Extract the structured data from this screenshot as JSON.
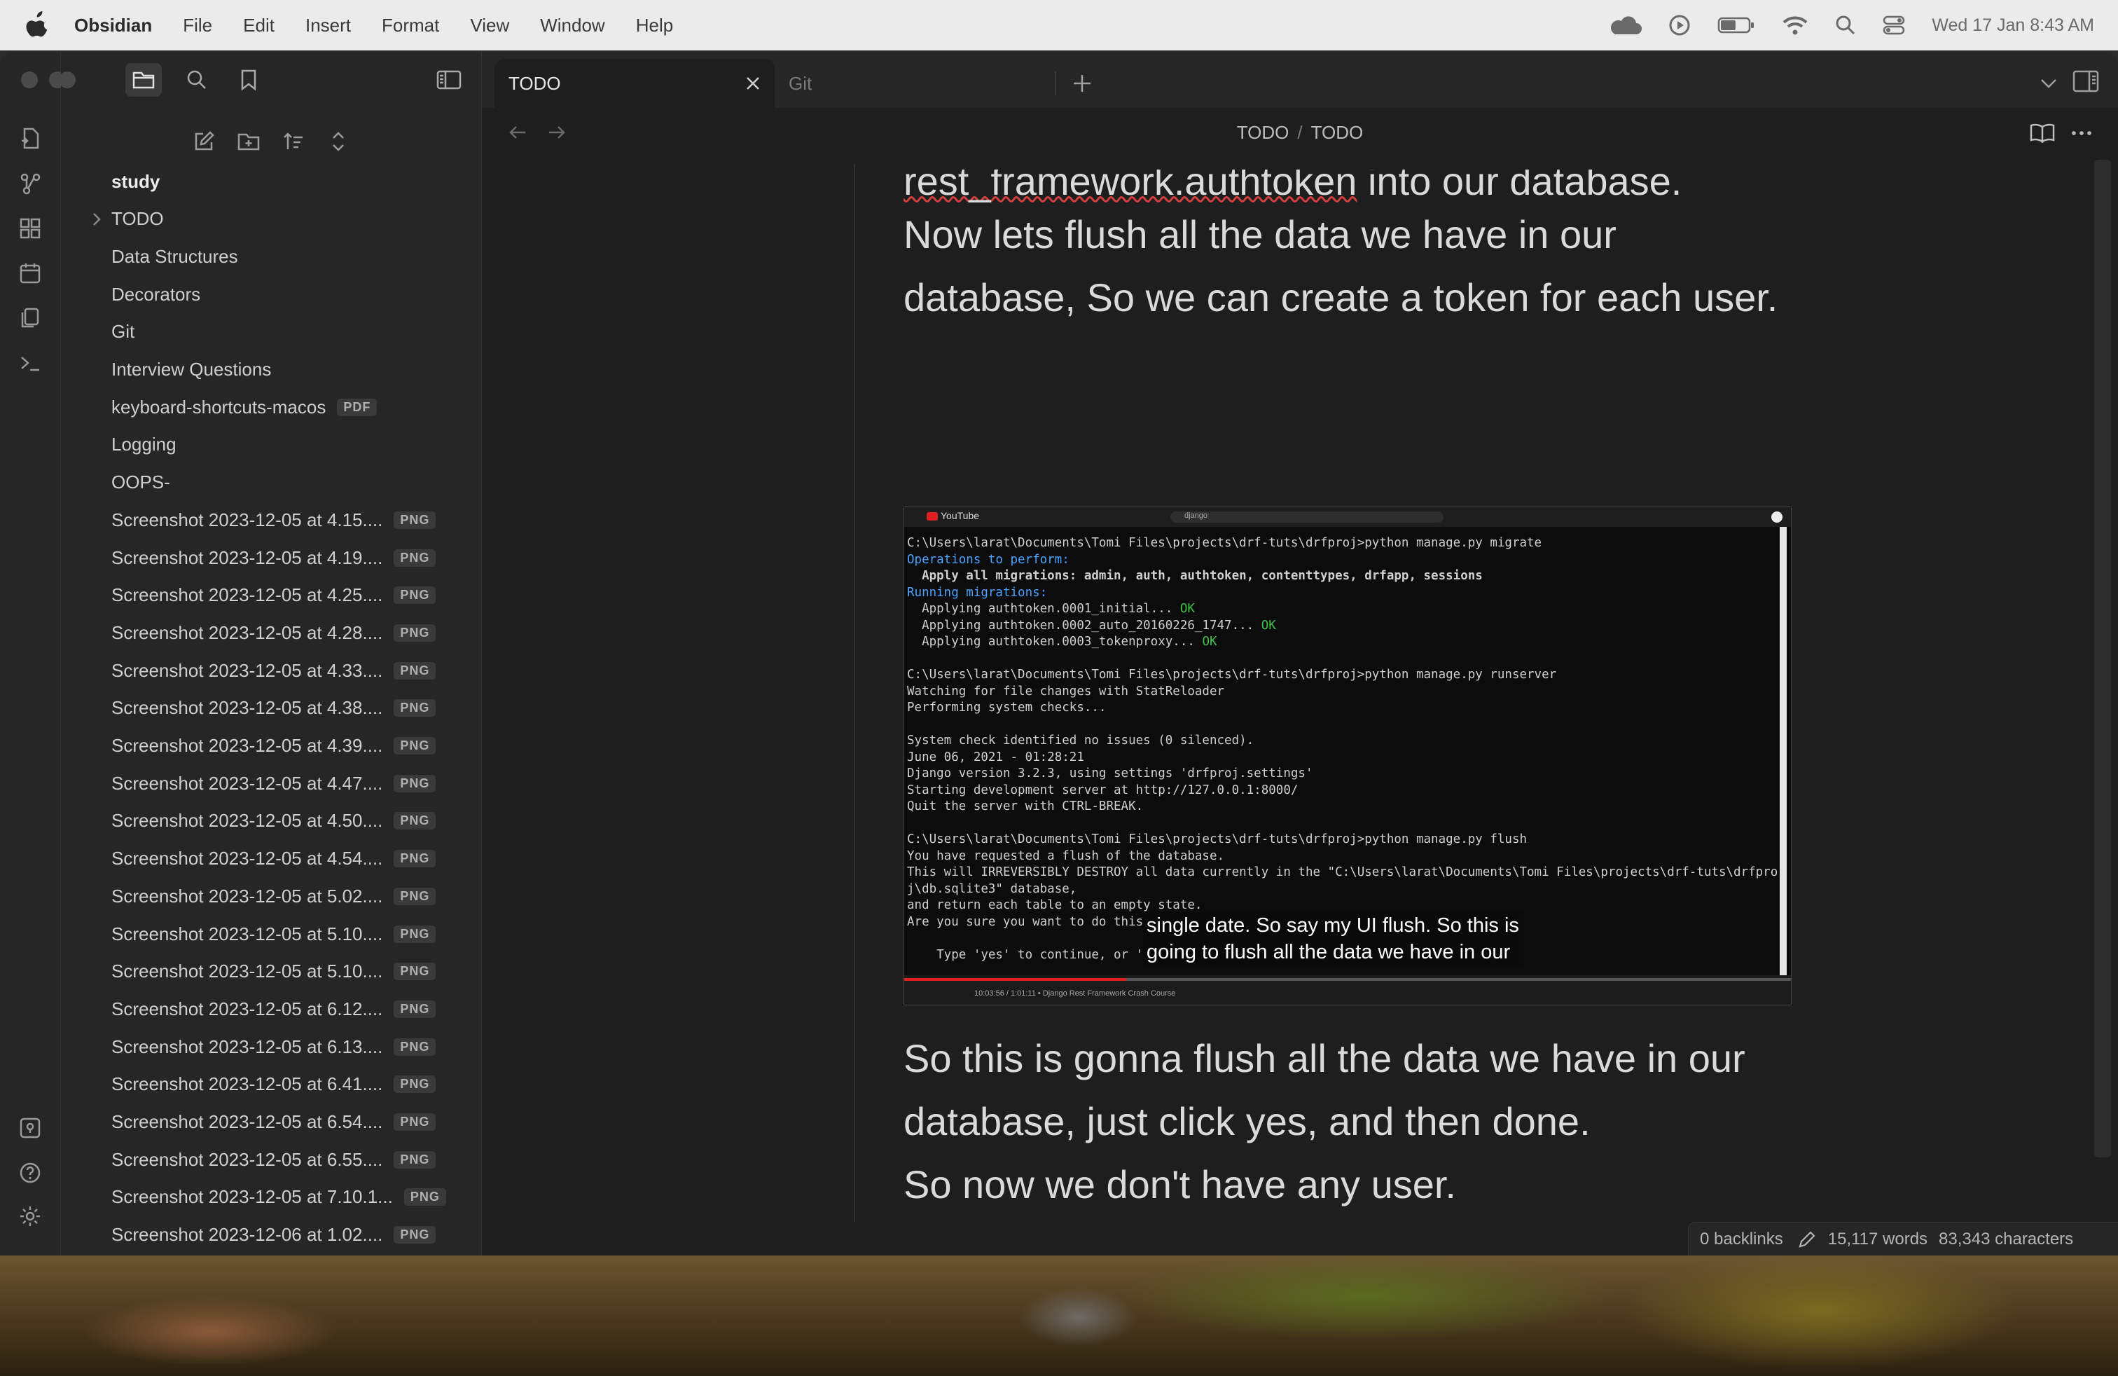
{
  "menubar": {
    "app_name": "Obsidian",
    "menus": [
      "File",
      "Edit",
      "Insert",
      "Format",
      "View",
      "Window",
      "Help"
    ],
    "datetime": "Wed 17 Jan  8:43 AM",
    "battery_percent": 55
  },
  "tabs": [
    {
      "label": "TODO",
      "active": true
    },
    {
      "label": "Git",
      "active": false
    }
  ],
  "breadcrumb": {
    "folder": "TODO",
    "separator": "/",
    "file": "TODO"
  },
  "file_tree": [
    {
      "label": "study",
      "type": "folder-open"
    },
    {
      "label": "TODO",
      "type": "folder-collapsed"
    },
    {
      "label": "Data Structures"
    },
    {
      "label": "Decorators"
    },
    {
      "label": "Git"
    },
    {
      "label": "Interview Questions"
    },
    {
      "label": "keyboard-shortcuts-macos",
      "badge": "PDF"
    },
    {
      "label": "Logging"
    },
    {
      "label": "OOPS-"
    },
    {
      "label": "Screenshot 2023-12-05 at 4.15....",
      "badge": "PNG"
    },
    {
      "label": "Screenshot 2023-12-05 at 4.19....",
      "badge": "PNG"
    },
    {
      "label": "Screenshot 2023-12-05 at 4.25....",
      "badge": "PNG"
    },
    {
      "label": "Screenshot 2023-12-05 at 4.28....",
      "badge": "PNG"
    },
    {
      "label": "Screenshot 2023-12-05 at 4.33....",
      "badge": "PNG"
    },
    {
      "label": "Screenshot 2023-12-05 at 4.38....",
      "badge": "PNG"
    },
    {
      "label": "Screenshot 2023-12-05 at 4.39....",
      "badge": "PNG"
    },
    {
      "label": "Screenshot 2023-12-05 at 4.47....",
      "badge": "PNG"
    },
    {
      "label": "Screenshot 2023-12-05 at 4.50....",
      "badge": "PNG"
    },
    {
      "label": "Screenshot 2023-12-05 at 4.54....",
      "badge": "PNG"
    },
    {
      "label": "Screenshot 2023-12-05 at 5.02....",
      "badge": "PNG"
    },
    {
      "label": "Screenshot 2023-12-05 at 5.10....",
      "badge": "PNG"
    },
    {
      "label": "Screenshot 2023-12-05 at 5.10....",
      "badge": "PNG"
    },
    {
      "label": "Screenshot 2023-12-05 at 6.12....",
      "badge": "PNG"
    },
    {
      "label": "Screenshot 2023-12-05 at 6.13....",
      "badge": "PNG"
    },
    {
      "label": "Screenshot 2023-12-05 at 6.41....",
      "badge": "PNG"
    },
    {
      "label": "Screenshot 2023-12-05 at 6.54....",
      "badge": "PNG"
    },
    {
      "label": "Screenshot 2023-12-05 at 6.55....",
      "badge": "PNG"
    },
    {
      "label": "Screenshot 2023-12-05 at 7.10.1...",
      "badge": "PNG"
    },
    {
      "label": "Screenshot 2023-12-06 at 1.02....",
      "badge": "PNG"
    }
  ],
  "note": {
    "line1_term": "rest_framework.authtoken",
    "line1_rest": " into our database.",
    "line2": "Now lets flush all the data we have in our",
    "line3": "database, So we can create a token for each user.",
    "line4": "So this is gonna flush all the data we have in our",
    "line5": "database, just click yes, and then done.",
    "line6": "So now we don't have any user."
  },
  "embedded_image": {
    "site": "YouTube",
    "search_text": "django",
    "terminal_lines": [
      {
        "text": "C:\\Users\\larat\\Documents\\Tomi Files\\projects\\drf-tuts\\drfproj>python manage.py migrate"
      },
      {
        "text": "Operations to perform:",
        "color": "blue"
      },
      {
        "text": "  Apply all migrations: admin, auth, authtoken, contenttypes, drfapp, sessions",
        "bold": true
      },
      {
        "text": "Running migrations:",
        "color": "blue"
      },
      {
        "text": "  Applying authtoken.0001_initial...",
        "ok": "OK"
      },
      {
        "text": "  Applying authtoken.0002_auto_20160226_1747...",
        "ok": "OK"
      },
      {
        "text": "  Applying authtoken.0003_tokenproxy...",
        "ok": "OK"
      },
      {
        "text": ""
      },
      {
        "text": "C:\\Users\\larat\\Documents\\Tomi Files\\projects\\drf-tuts\\drfproj>python manage.py runserver"
      },
      {
        "text": "Watching for file changes with StatReloader"
      },
      {
        "text": "Performing system checks..."
      },
      {
        "text": ""
      },
      {
        "text": "System check identified no issues (0 silenced)."
      },
      {
        "text": "June 06, 2021 - 01:28:21"
      },
      {
        "text": "Django version 3.2.3, using settings 'drfproj.settings'"
      },
      {
        "text": "Starting development server at http://127.0.0.1:8000/"
      },
      {
        "text": "Quit the server with CTRL-BREAK."
      },
      {
        "text": ""
      },
      {
        "text": "C:\\Users\\larat\\Documents\\Tomi Files\\projects\\drf-tuts\\drfproj>python manage.py flush"
      },
      {
        "text": "You have requested a flush of the database."
      },
      {
        "text": "This will IRREVERSIBLY DESTROY all data currently in the \"C:\\Users\\larat\\Documents\\Tomi Files\\projects\\drf-tuts\\drfpro"
      },
      {
        "text": "j\\db.sqlite3\" database,"
      },
      {
        "text": "and return each table to an empty state."
      },
      {
        "text": "Are you sure you want to do this"
      },
      {
        "text": ""
      },
      {
        "text": "    Type 'yes' to continue, or '"
      }
    ],
    "caption_line1": "single date. So say my UI flush. So this is",
    "caption_line2": "going to flush all the data we have in our",
    "player_time": "10:03:56 / 1:01:11 • Django Rest Framework Crash Course",
    "progress_fraction": 0.25
  },
  "status_bar": {
    "backlinks": "0 backlinks",
    "words": "15,117 words",
    "characters": "83,343 characters"
  },
  "colors": {
    "accent_red": "#e02020",
    "terminal_blue": "#4aa3ff",
    "terminal_green": "#3ec24a"
  }
}
